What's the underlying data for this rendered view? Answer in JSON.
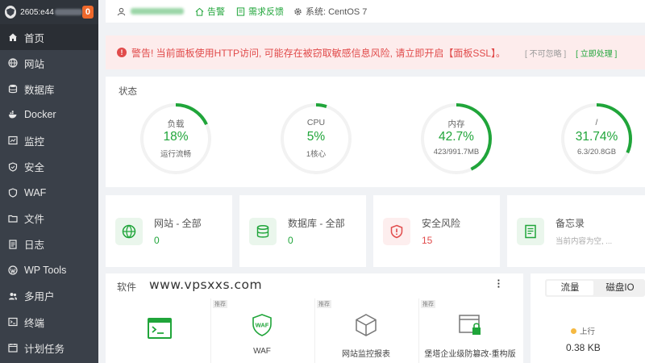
{
  "sidebar": {
    "host_prefix": "2605:e44",
    "badge": "0",
    "items": [
      {
        "label": "首页",
        "icon": "home-icon"
      },
      {
        "label": "网站",
        "icon": "globe-icon"
      },
      {
        "label": "数据库",
        "icon": "database-icon"
      },
      {
        "label": "Docker",
        "icon": "docker-icon"
      },
      {
        "label": "监控",
        "icon": "monitor-icon"
      },
      {
        "label": "安全",
        "icon": "shield-icon"
      },
      {
        "label": "WAF",
        "icon": "waf-shield-icon"
      },
      {
        "label": "文件",
        "icon": "folder-icon"
      },
      {
        "label": "日志",
        "icon": "log-icon"
      },
      {
        "label": "WP Tools",
        "icon": "wordpress-icon"
      },
      {
        "label": "多用户",
        "icon": "users-icon"
      },
      {
        "label": "终端",
        "icon": "terminal-icon"
      },
      {
        "label": "计划任务",
        "icon": "calendar-icon"
      }
    ]
  },
  "topbar": {
    "alarm": "告警",
    "feedback": "需求反馈",
    "system": "系统:  CentOS 7"
  },
  "alert": {
    "message": "警告! 当前面板使用HTTP访问, 可能存在被窃取敏感信息风险, 请立即开启【面板SSL】。",
    "ignore": "[ 不可忽略 ]",
    "fix": "[ 立即处理 ]"
  },
  "status": {
    "title": "状态",
    "gauges": [
      {
        "label": "负载",
        "value": "18%",
        "sub": "运行流畅",
        "percent": 18
      },
      {
        "label": "CPU",
        "value": "5%",
        "sub": "1核心",
        "percent": 5
      },
      {
        "label": "内存",
        "value": "42.7%",
        "sub": "423/991.7MB",
        "percent": 42.7
      },
      {
        "label": "/",
        "value": "31.74%",
        "sub": "6.3/20.8GB",
        "percent": 31.74
      }
    ]
  },
  "stats": [
    {
      "label": "网站 - 全部",
      "value": "0",
      "icon": "globe-icon"
    },
    {
      "label": "数据库 - 全部",
      "value": "0",
      "icon": "database-icon"
    },
    {
      "label": "安全风险",
      "value": "15",
      "icon": "risk-shield-icon"
    },
    {
      "label": "备忘录",
      "value": "当前内容为空, ...",
      "icon": "memo-icon"
    }
  ],
  "software": {
    "title": "软件",
    "watermark": "www.vpsxxs.com",
    "tag": "推荐",
    "items": [
      {
        "name": "",
        "icon": "terminal-app-icon"
      },
      {
        "name": "WAF",
        "icon": "waf-icon"
      },
      {
        "name": "网站监控报表",
        "icon": "cube-icon"
      },
      {
        "name": "堡塔企业级防篡改-重构版",
        "icon": "tamper-lock-icon"
      }
    ]
  },
  "traffic": {
    "tabs": [
      "流量",
      "磁盘IO"
    ],
    "upload_label": "上行",
    "upload_value": "0.38 KB"
  },
  "colors": {
    "accent": "#20a53a",
    "danger": "#e14b4b",
    "sidebar_bg": "#3a4049"
  }
}
